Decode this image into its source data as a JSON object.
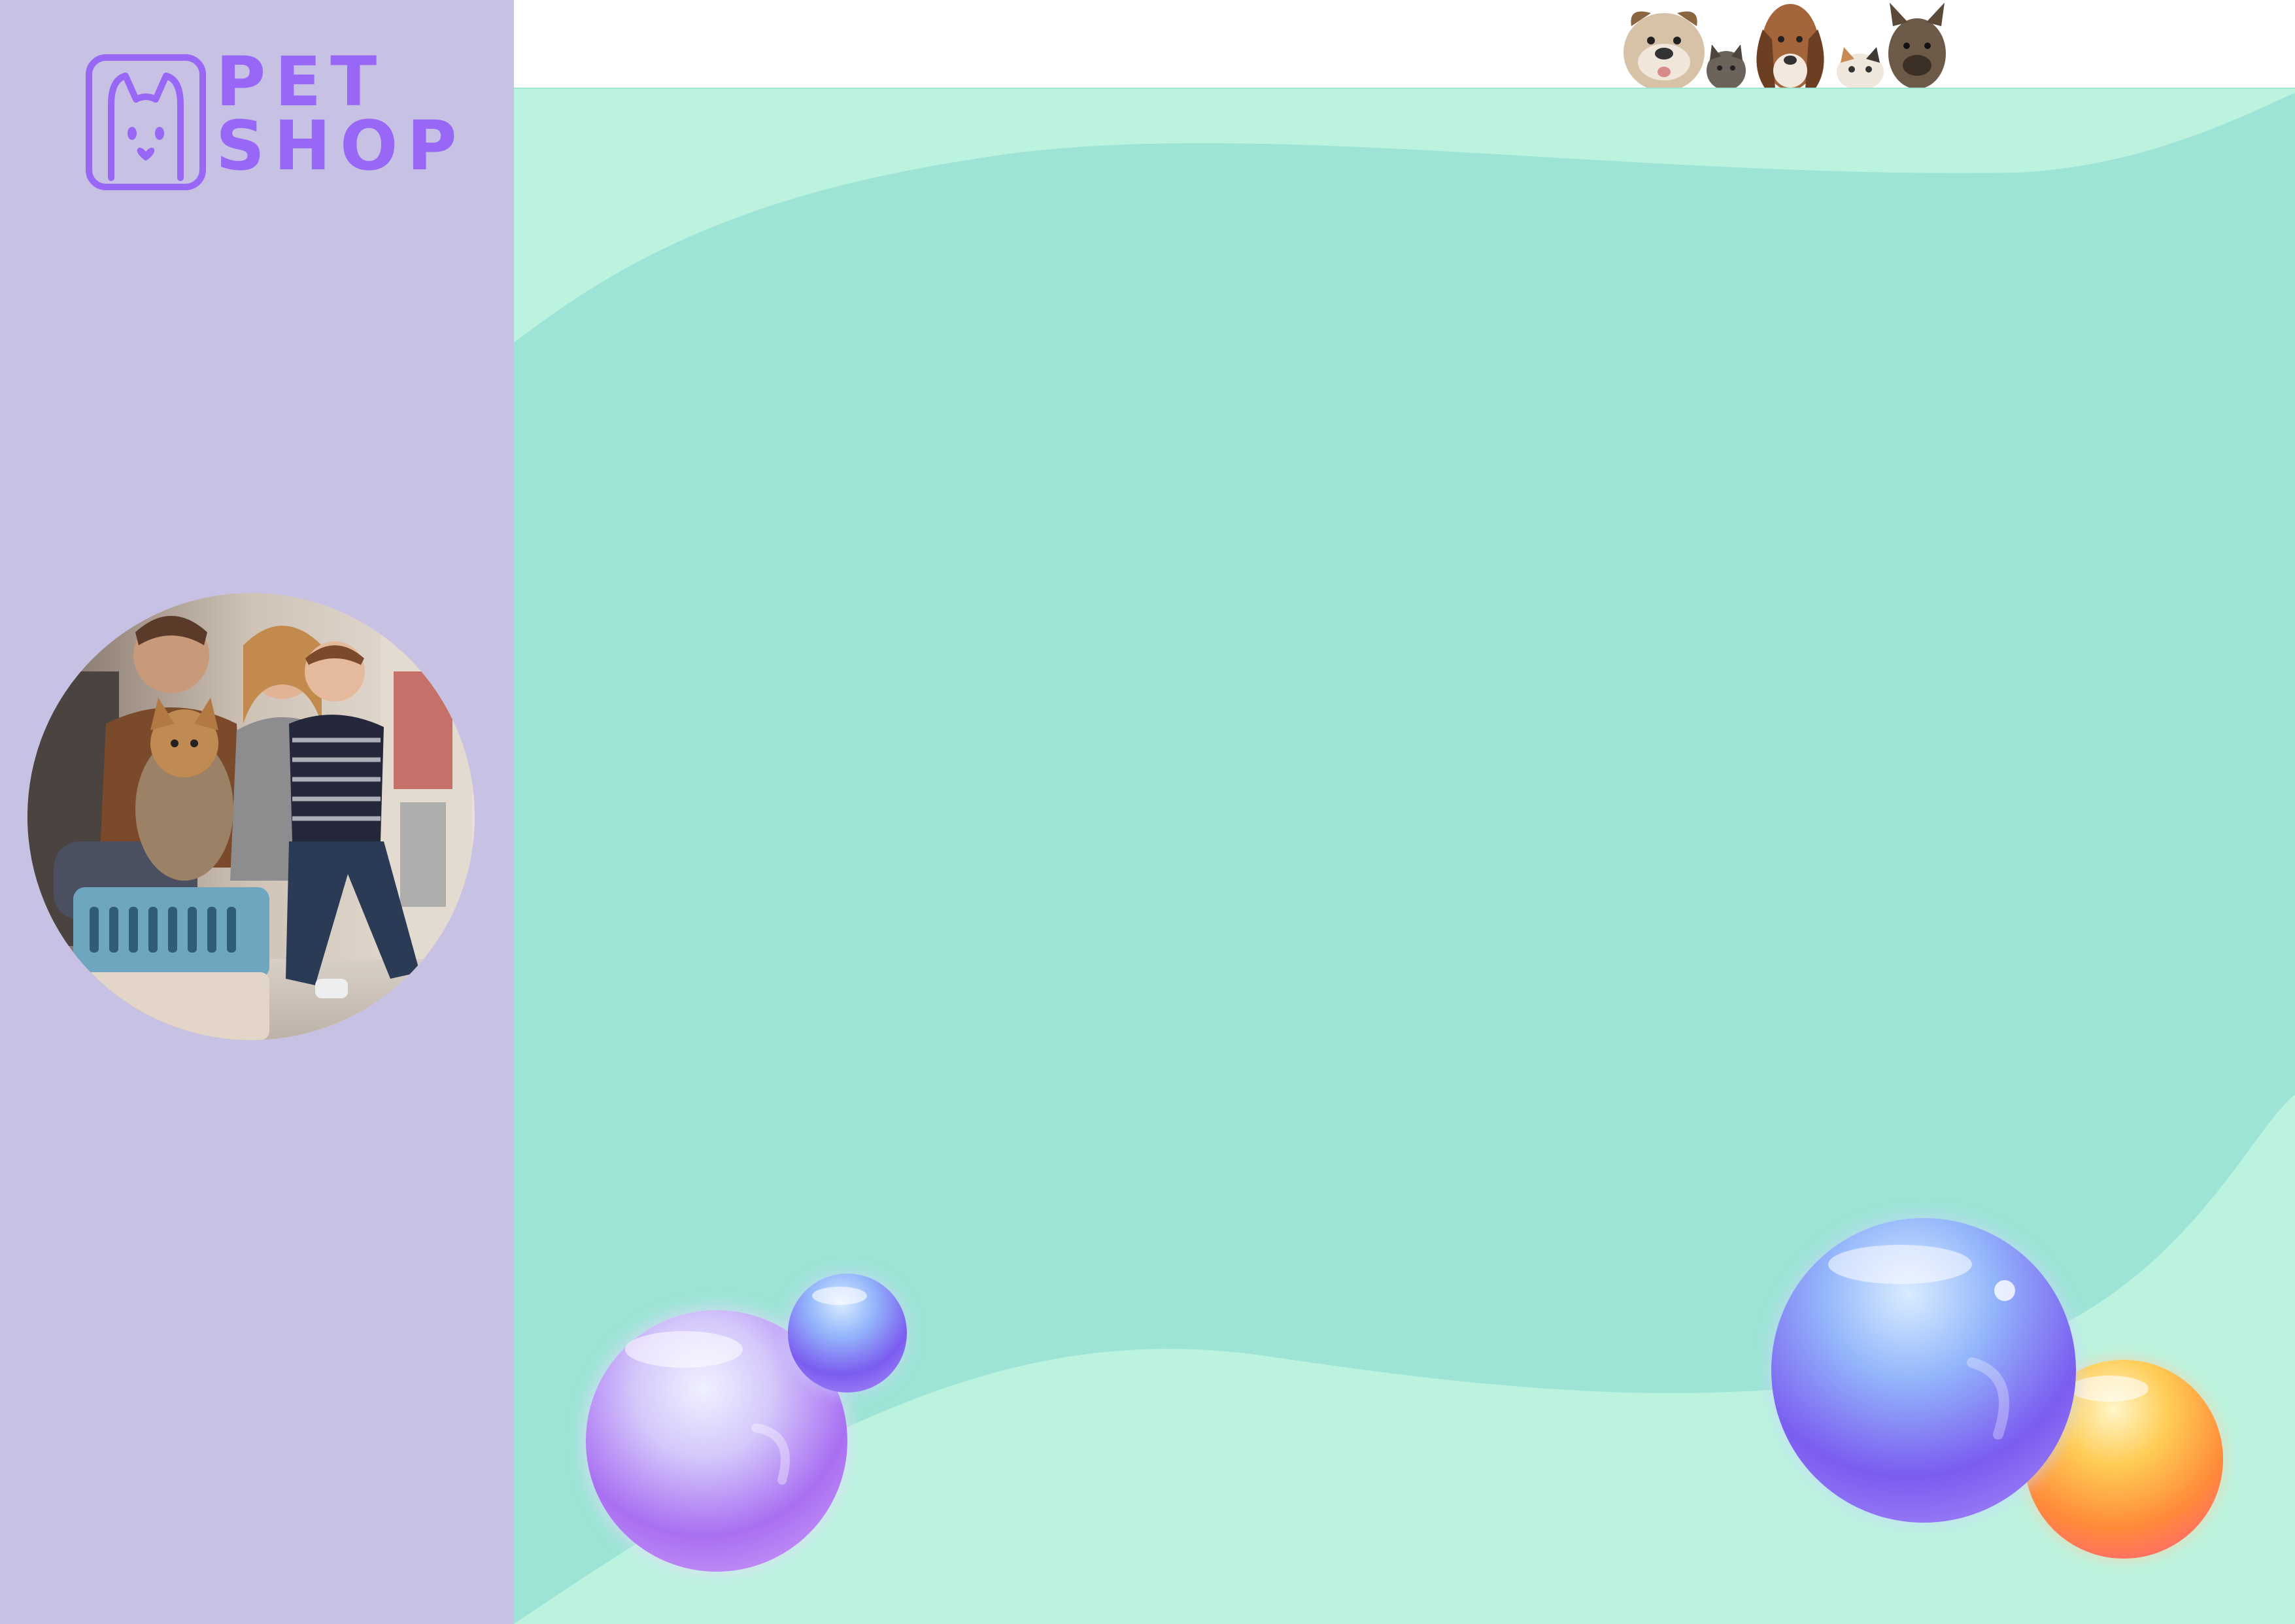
{
  "logo": {
    "line1": "PET",
    "line2": "SHOP"
  },
  "colors": {
    "sidebar_bg": "#c7c2e3",
    "brand_purple": "#9867f5",
    "panel_light": "#bbf3df",
    "panel_mid": "#9de4d6"
  },
  "icons": {
    "logo": "cat-face-icon"
  }
}
